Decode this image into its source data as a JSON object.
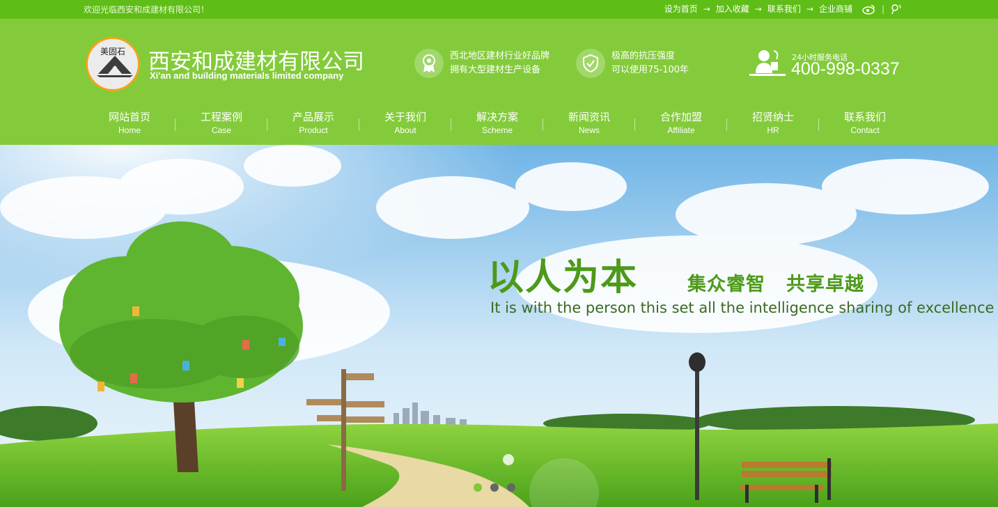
{
  "topbar": {
    "welcome": "欢迎光临西安和成建材有限公司！",
    "links": [
      "设为首页",
      "加入收藏",
      "联系我们",
      "企业商铺"
    ],
    "arrow": "→",
    "sep": "|",
    "icons": [
      "weibo-icon",
      "tencent-weibo-icon"
    ]
  },
  "header": {
    "logo_text": "美固石",
    "company_cn": "西安和成建材有限公司",
    "company_en": "Xi'an and building materials limited company",
    "features": [
      {
        "icon": "medal-icon",
        "line1": "西北地区建材行业好品牌",
        "line2": "拥有大型建材生产设备"
      },
      {
        "icon": "shield-check-icon",
        "line1": "极高的抗压强度",
        "line2": "可以使用75-100年"
      }
    ],
    "phone_label": "24小时服务电话",
    "phone_number": "400-998-0337"
  },
  "nav": [
    {
      "cn": "网站首页",
      "en": "Home"
    },
    {
      "cn": "工程案例",
      "en": "Case"
    },
    {
      "cn": "产品展示",
      "en": "Product"
    },
    {
      "cn": "关于我们",
      "en": "About"
    },
    {
      "cn": "解决方案",
      "en": "Scheme"
    },
    {
      "cn": "新闻资讯",
      "en": "News"
    },
    {
      "cn": "合作加盟",
      "en": "Affiliate"
    },
    {
      "cn": "招贤纳士",
      "en": "HR"
    },
    {
      "cn": "联系我们",
      "en": "Contact"
    }
  ],
  "banner": {
    "slogan_cn": "以人为本",
    "slogan_cn2a": "集众睿智",
    "slogan_cn2b": "共享卓越",
    "slogan_en": "It is with the person this set all the intelligence sharing of excellence",
    "slides": 3,
    "active_slide": 1
  },
  "colors": {
    "topbar": "#5fbd17",
    "header": "#83cb3a",
    "slogan": "#4d9a19",
    "dot_active": "#7fc83a",
    "dot_inactive": "#666666"
  }
}
